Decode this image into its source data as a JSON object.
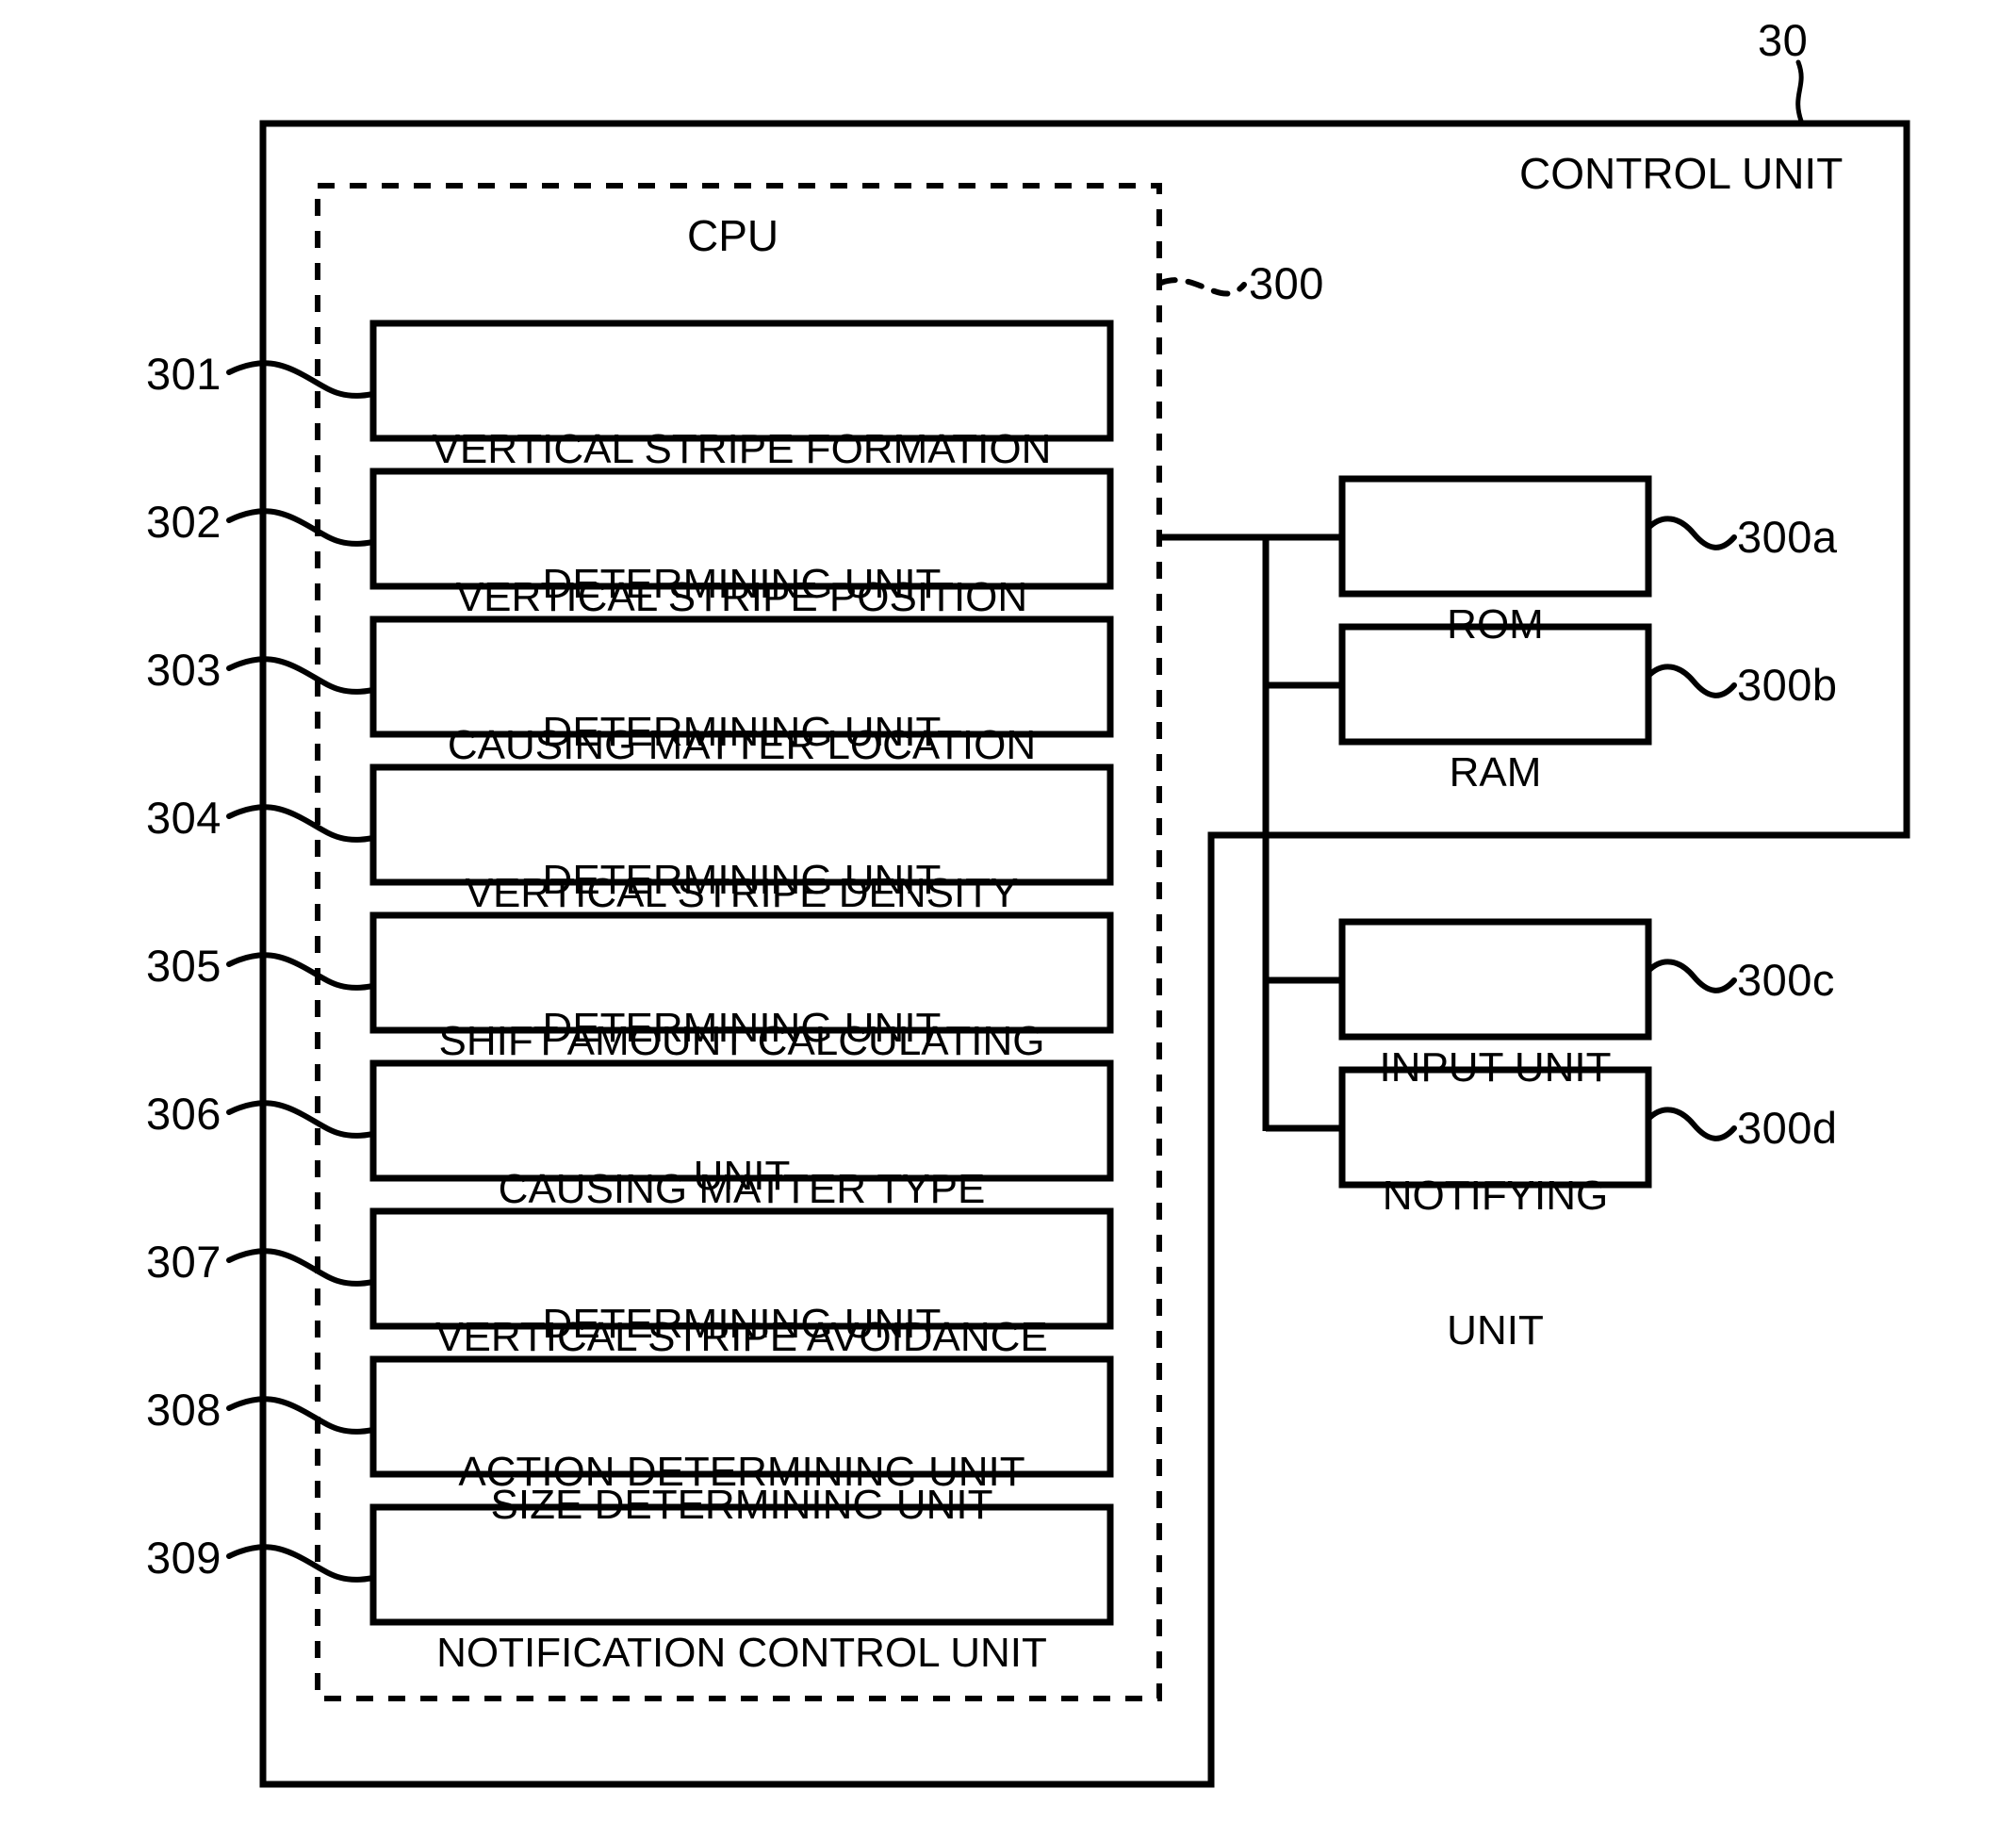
{
  "diagram": {
    "outer_box": {
      "title": "CONTROL UNIT",
      "ref": "30"
    },
    "cpu_box": {
      "title": "CPU",
      "ref": "300"
    },
    "cpu_blocks": [
      {
        "ref": "301",
        "line1": "VERTICAL STRIPE FORMATION",
        "line2": "DETERMINING UNIT"
      },
      {
        "ref": "302",
        "line1": "VERTICAL STRIPE POSITION",
        "line2": "DETERMINING UNIT"
      },
      {
        "ref": "303",
        "line1": "CAUSING MATTER LOCATION",
        "line2": "DETERMINING UNIT"
      },
      {
        "ref": "304",
        "line1": "VERTICAL STRIPE DENSITY",
        "line2": "DETERMINING UNIT"
      },
      {
        "ref": "305",
        "line1": "SHIFT AMOUNT CALCULATING",
        "line2": "UNIT"
      },
      {
        "ref": "306",
        "line1": "CAUSING MATTER TYPE",
        "line2": "DETERMINING UNIT"
      },
      {
        "ref": "307",
        "line1": "VERTICAL STRIPE AVOIDANCE",
        "line2": "ACTION DETERMINING UNIT"
      },
      {
        "ref": "308",
        "line1": "SIZE DETERMINING UNIT",
        "line2": ""
      },
      {
        "ref": "309",
        "line1": "NOTIFICATION CONTROL UNIT",
        "line2": ""
      }
    ],
    "peripherals": [
      {
        "ref": "300a",
        "line1": "ROM",
        "line2": ""
      },
      {
        "ref": "300b",
        "line1": "RAM",
        "line2": ""
      },
      {
        "ref": "300c",
        "line1": "INPUT UNIT",
        "line2": ""
      },
      {
        "ref": "300d",
        "line1": "NOTIFYING",
        "line2": "UNIT"
      }
    ],
    "colors": {
      "ink": "#000000",
      "background": "#ffffff"
    }
  }
}
